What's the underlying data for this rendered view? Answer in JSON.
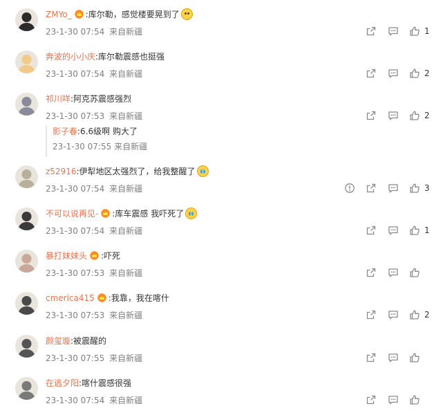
{
  "comments": [
    {
      "user": "ZMYo_",
      "vip": true,
      "text": ":库尔勒，感觉楼要晃到了",
      "emoji": "smile",
      "time": "23-1-30 07:54",
      "source": "来自新疆",
      "likes": "1",
      "report": false
    },
    {
      "user": "奔波的小小庆",
      "vip": false,
      "text": ":库尔勒震感也挺强",
      "emoji": "",
      "time": "23-1-30 07:54",
      "source": "来自新疆",
      "likes": "2",
      "report": false
    },
    {
      "user": "祁川咩",
      "vip": false,
      "text": ":阿克苏震感强烈",
      "emoji": "",
      "time": "23-1-30 07:53",
      "source": "来自新疆",
      "likes": "2",
      "report": false,
      "reply": {
        "user": "影子春",
        "text": ":6.6级啊 购大了",
        "time": "23-1-30 07:55",
        "source": "来自新疆"
      }
    },
    {
      "user": "z52916",
      "vip": false,
      "text": ":伊犁地区太强烈了，给我整醒了",
      "emoji": "cry",
      "time": "23-1-30 07:54",
      "source": "来自新疆",
      "likes": "3",
      "report": true
    },
    {
      "user": "不可以说再见-",
      "vip": true,
      "text": ":库车震感 我吓死了",
      "emoji": "cry",
      "time": "23-1-30 07:54",
      "source": "来自新疆",
      "likes": "1",
      "report": false
    },
    {
      "user": "暴打妹妹头",
      "vip": true,
      "text": ":吓死",
      "emoji": "",
      "time": "23-1-30 07:53",
      "source": "来自新疆",
      "likes": "",
      "report": false
    },
    {
      "user": "cmerica415",
      "vip": true,
      "text": ":我靠，我在喀什",
      "emoji": "",
      "time": "23-1-30 07:53",
      "source": "来自新疆",
      "likes": "2",
      "report": false
    },
    {
      "user": "颜玺璇",
      "vip": false,
      "text": ":被震醒的",
      "emoji": "",
      "time": "23-1-30 07:55",
      "source": "来自新疆",
      "likes": "",
      "report": false
    },
    {
      "user": "在逃夕阳",
      "vip": false,
      "text": ":喀什震感很强",
      "emoji": "",
      "time": "23-1-30 07:54",
      "source": "来自新疆",
      "likes": "",
      "report": false
    }
  ],
  "icons": {
    "forward": "share-icon",
    "comment": "comment-icon",
    "like": "thumbs-up-icon",
    "report": "report-icon",
    "vip": "vip-crown-icon"
  },
  "colors": {
    "username": "#eb7350",
    "meta": "#808080",
    "icon": "#8a8a8a"
  }
}
